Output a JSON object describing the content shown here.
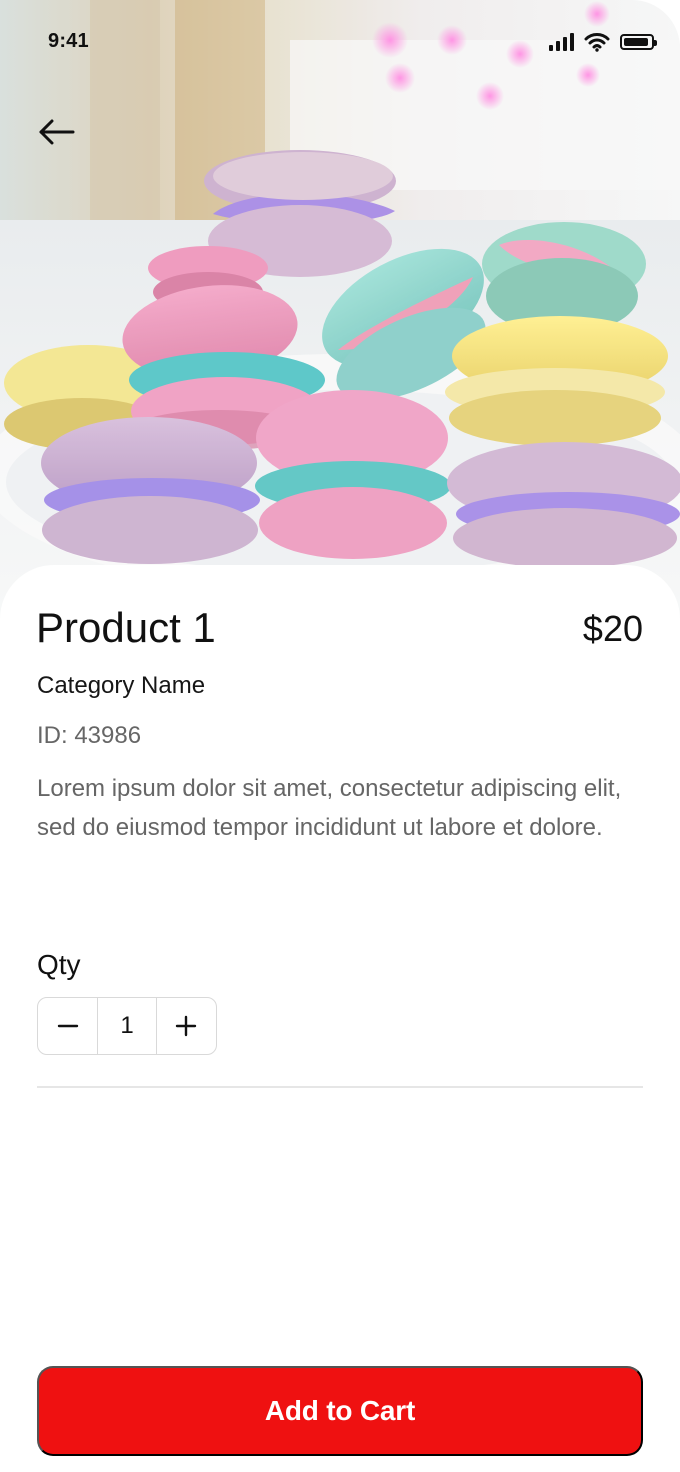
{
  "status_bar": {
    "time": "9:41",
    "icons": [
      "signal-icon",
      "wifi-icon",
      "battery-icon"
    ]
  },
  "navigation": {
    "back_icon": "back-arrow-icon"
  },
  "product": {
    "name": "Product 1",
    "price": "$20",
    "category": "Category Name",
    "id": "ID: 43986",
    "description": "Lorem ipsum dolor sit amet, consectetur adipiscing elit, sed do eiusmod tempor incididunt ut labore et dolore."
  },
  "quantity": {
    "label": "Qty",
    "value": "1",
    "decrement_icon": "minus-icon",
    "increment_icon": "plus-icon"
  },
  "actions": {
    "add_to_cart": "Add to Cart"
  },
  "colors": {
    "primary": "#ef1111",
    "text": "#111111",
    "muted_text": "#666666",
    "border": "#d9d9d9"
  }
}
